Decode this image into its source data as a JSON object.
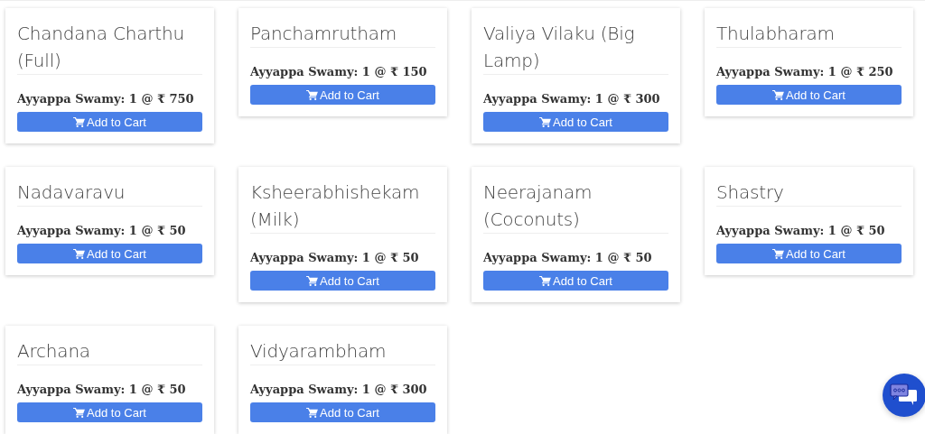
{
  "items": [
    {
      "title": "Chandana Charthu (Full)",
      "price": "Ayyappa Swamy: 1 @ ₹ 750",
      "button": "Add to Cart"
    },
    {
      "title": "Panchamrutham",
      "price": "Ayyappa Swamy: 1 @ ₹ 150",
      "button": "Add to Cart"
    },
    {
      "title": "Valiya Vilaku (Big Lamp)",
      "price": "Ayyappa Swamy: 1 @ ₹ 300",
      "button": "Add to Cart"
    },
    {
      "title": "Thulabharam",
      "price": "Ayyappa Swamy: 1 @ ₹ 250",
      "button": "Add to Cart"
    },
    {
      "title": "Nadavaravu",
      "price": "Ayyappa Swamy: 1 @ ₹ 50",
      "button": "Add to Cart"
    },
    {
      "title": "Ksheerabhishekam (Milk)",
      "price": "Ayyappa Swamy: 1 @ ₹ 50",
      "button": "Add to Cart"
    },
    {
      "title": "Neerajanam (Coconuts)",
      "price": "Ayyappa Swamy: 1 @ ₹ 50",
      "button": "Add to Cart"
    },
    {
      "title": "Shastry",
      "price": "Ayyappa Swamy: 1 @ ₹ 50",
      "button": "Add to Cart"
    },
    {
      "title": "Archana",
      "price": "Ayyappa Swamy: 1 @ ₹ 50",
      "button": "Add to Cart"
    },
    {
      "title": "Vidyarambham",
      "price": "Ayyappa Swamy: 1 @ ₹ 300",
      "button": "Add to Cart"
    }
  ]
}
